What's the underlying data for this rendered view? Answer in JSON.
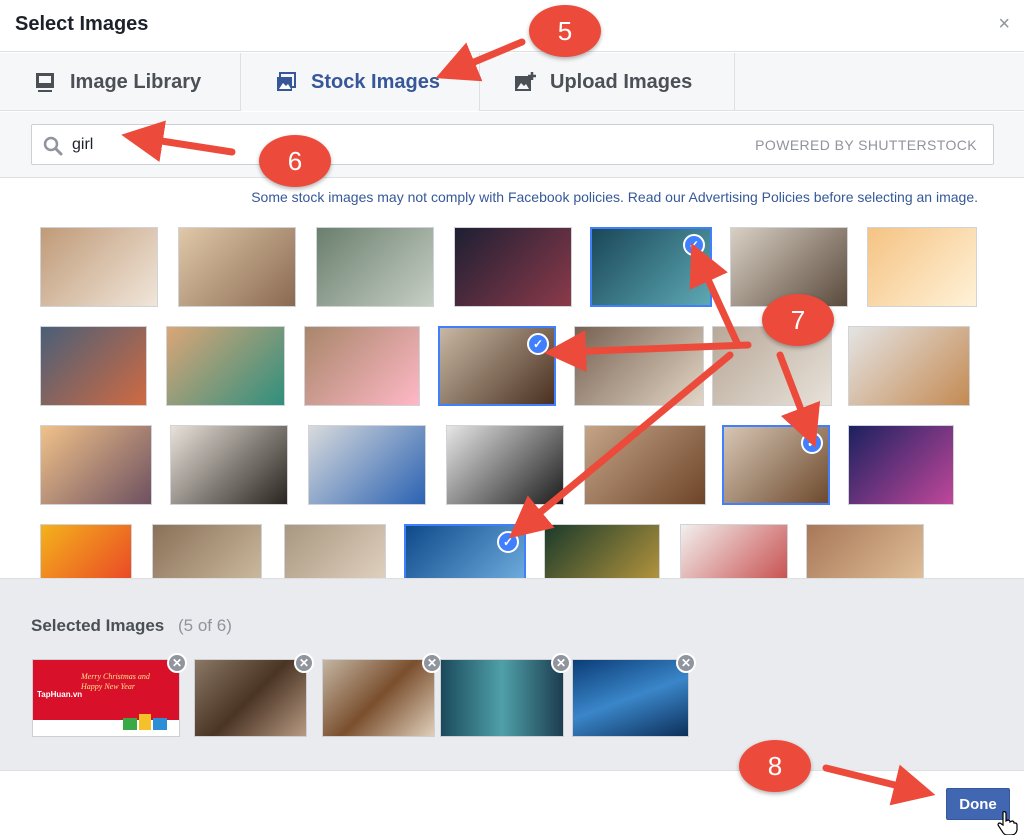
{
  "dialog": {
    "title": "Select Images",
    "close_glyph": "×"
  },
  "tabs": [
    {
      "label": "Image Library",
      "icon": "image-library-icon",
      "active": false
    },
    {
      "label": "Stock Images",
      "icon": "stock-images-icon",
      "active": true
    },
    {
      "label": "Upload Images",
      "icon": "upload-images-icon",
      "active": false
    }
  ],
  "search": {
    "value": "girl",
    "powered_by": "POWERED BY SHUTTERSTOCK"
  },
  "policy_notice": "Some stock images may not comply with Facebook policies. Read our Advertising Policies before selecting an image.",
  "selected": {
    "title": "Selected Images",
    "count": "(5 of 6)"
  },
  "done_label": "Done",
  "annotations": [
    "5",
    "6",
    "7",
    "8"
  ],
  "colors": {
    "accent": "#4080ff",
    "brand": "#4267b2",
    "link": "#365899",
    "annotation": "#ec4b3b"
  },
  "grid_images": [
    {
      "selected": false
    },
    {
      "selected": false
    },
    {
      "selected": false
    },
    {
      "selected": false
    },
    {
      "selected": true
    },
    {
      "selected": false
    },
    {
      "selected": false
    },
    {
      "selected": false
    },
    {
      "selected": false
    },
    {
      "selected": false
    },
    {
      "selected": true
    },
    {
      "selected": false
    },
    {
      "selected": false
    },
    {
      "selected": false
    },
    {
      "selected": false
    },
    {
      "selected": false
    },
    {
      "selected": false
    },
    {
      "selected": false
    },
    {
      "selected": false
    },
    {
      "selected": true
    },
    {
      "selected": false
    },
    {
      "selected": false
    },
    {
      "selected": false
    },
    {
      "selected": false
    },
    {
      "selected": true
    },
    {
      "selected": false
    },
    {
      "selected": false
    },
    {
      "selected": false
    }
  ],
  "selected_thumb_banner": {
    "brand": "TapHuan.vn",
    "greeting": "Merry Christmas and Happy New Year"
  }
}
